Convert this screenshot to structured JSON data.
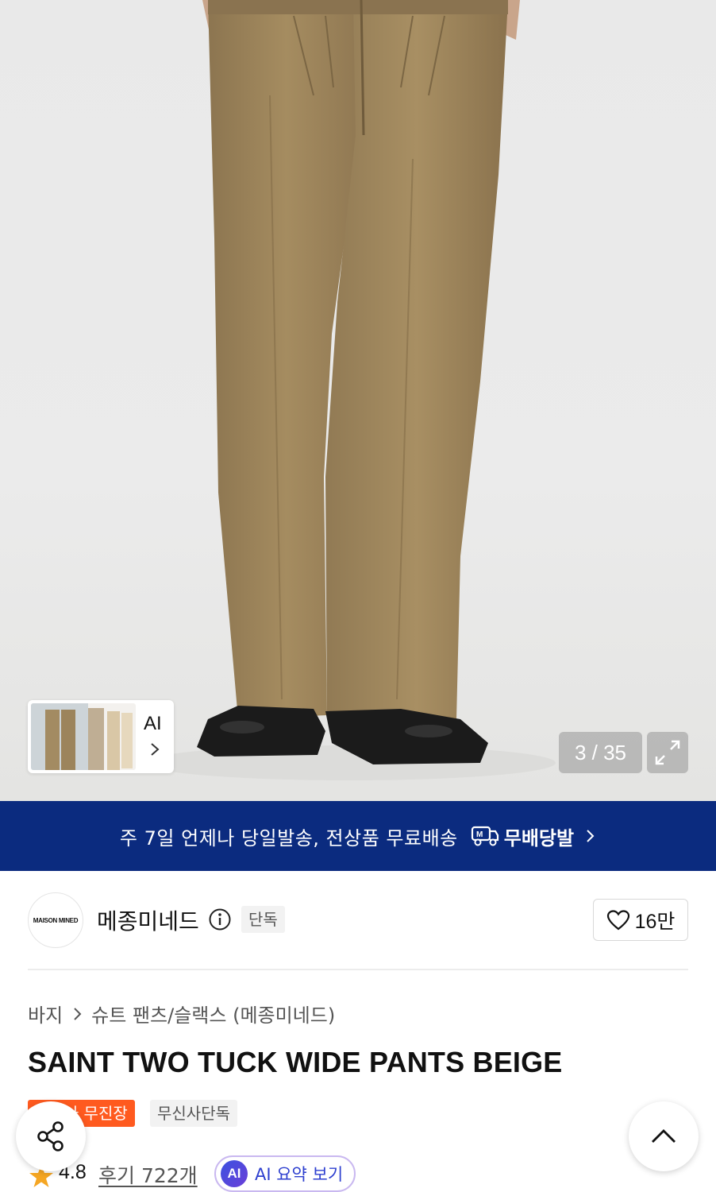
{
  "gallery": {
    "thumbnail_label": "AI",
    "counter": "3 / 35"
  },
  "banner": {
    "text": "주 7일 언제나 당일발송, 전상품 무료배송",
    "logo_text": "무배당발"
  },
  "brand": {
    "logo_text": "MAISON MINED",
    "name": "메종미네드",
    "tag": "단독",
    "likes": "16만"
  },
  "breadcrumb": {
    "category": "바지",
    "subcategory": "슈트 팬츠/슬랙스 (메종미네드)"
  },
  "product": {
    "title": "SAINT TWO TUCK WIDE PANTS BEIGE",
    "badges": [
      "무신사 무진장",
      "무신사단독"
    ]
  },
  "rating": {
    "score": "4.8",
    "reviews": "후기 722개",
    "ai_summary_icon": "AI",
    "ai_summary_label": "AI 요약 보기"
  },
  "colors": {
    "banner_bg": "#0b2b7f",
    "badge_orange": "#ff5a1f",
    "pants": "#9a8258",
    "star": "#f5a623"
  },
  "icons": [
    "chevron-right-icon",
    "expand-icon",
    "delivery-truck-icon",
    "info-icon",
    "heart-icon",
    "star-icon",
    "share-icon",
    "chevron-up-icon"
  ]
}
